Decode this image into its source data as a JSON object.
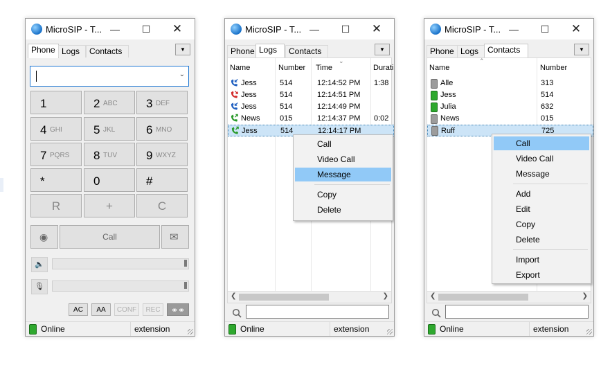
{
  "win1": {
    "title": "MicroSIP - T...",
    "tabs": [
      "Phone",
      "Logs",
      "Contacts"
    ],
    "keys": [
      {
        "d": "1",
        "l": ""
      },
      {
        "d": "2",
        "l": "ABC"
      },
      {
        "d": "3",
        "l": "DEF"
      },
      {
        "d": "4",
        "l": "GHI"
      },
      {
        "d": "5",
        "l": "JKL"
      },
      {
        "d": "6",
        "l": "MNO"
      },
      {
        "d": "7",
        "l": "PQRS"
      },
      {
        "d": "8",
        "l": "TUV"
      },
      {
        "d": "9",
        "l": "WXYZ"
      },
      {
        "d": "*",
        "l": ""
      },
      {
        "d": "0",
        "l": ""
      },
      {
        "d": "#",
        "l": ""
      }
    ],
    "controls": {
      "r": "R",
      "plus": "+",
      "c": "C"
    },
    "call_label": "Call",
    "small_buttons": [
      "AC",
      "AA",
      "CONF",
      "REC"
    ],
    "status": "Online",
    "ext": "extension"
  },
  "win2": {
    "title": "MicroSIP - T...",
    "tabs": [
      "Phone",
      "Logs",
      "Contacts"
    ],
    "columns": [
      "Name",
      "Number",
      "Time",
      "Durati"
    ],
    "rows": [
      {
        "name": "Jess",
        "number": "514",
        "time": "12:14:52 PM",
        "duration": "1:38",
        "icon": "blue"
      },
      {
        "name": "Jess",
        "number": "514",
        "time": "12:14:51 PM",
        "duration": "",
        "icon": "red"
      },
      {
        "name": "Jess",
        "number": "514",
        "time": "12:14:49 PM",
        "duration": "",
        "icon": "blue"
      },
      {
        "name": "News",
        "number": "015",
        "time": "12:14:37 PM",
        "duration": "0:02",
        "icon": "green"
      },
      {
        "name": "Jess",
        "number": "514",
        "time": "12:14:17 PM",
        "duration": "",
        "icon": "green"
      }
    ],
    "menu": [
      "Call",
      "Video Call",
      "Message",
      "Copy",
      "Delete"
    ],
    "status": "Online",
    "ext": "extension"
  },
  "win3": {
    "title": "MicroSIP - T...",
    "tabs": [
      "Phone",
      "Logs",
      "Contacts"
    ],
    "columns": [
      "Name",
      "Number"
    ],
    "rows": [
      {
        "name": "Alle",
        "number": "313",
        "state": "offline"
      },
      {
        "name": "Jess",
        "number": "514",
        "state": "online"
      },
      {
        "name": "Julia",
        "number": "632",
        "state": "online"
      },
      {
        "name": "News",
        "number": "015",
        "state": "offline"
      },
      {
        "name": "Ruff",
        "number": "725",
        "state": "offline"
      }
    ],
    "menu": [
      "Call",
      "Video Call",
      "Message",
      "Add",
      "Edit",
      "Copy",
      "Delete",
      "Import",
      "Export"
    ],
    "status": "Online",
    "ext": "extension"
  }
}
